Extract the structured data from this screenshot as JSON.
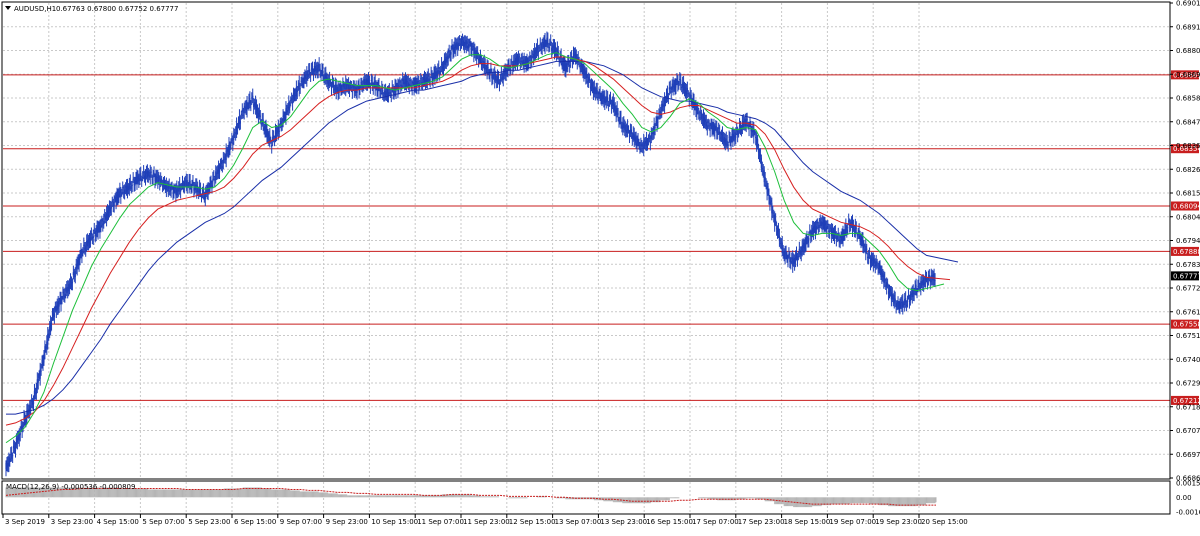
{
  "header": {
    "symbol": "AUDUSD,H1",
    "ohlc": "0.67763 0.67800 0.67752 0.67777",
    "indicator": "MACD(12,26,9) -0.000536 -0.000809"
  },
  "colors": {
    "candle": "#1f3fb8",
    "ma_fast": "#1dbf3a",
    "ma_mid": "#d62020",
    "ma_slow": "#1a2fa8",
    "level": "#c81e1e",
    "grid": "#c9c9c9",
    "macd_signal": "#c81e1e",
    "macd_hist": "#b5b5b5"
  },
  "chart_data": {
    "type": "candlestick",
    "y_axis": {
      "min": 0.6686,
      "max": 0.69015,
      "ticks": [
        "0.69015",
        "0.68910",
        "0.68800",
        "0.68695",
        "0.68585",
        "0.68475",
        "0.68365",
        "0.68260",
        "0.68150",
        "0.68045",
        "0.67940",
        "0.67830",
        "0.67725",
        "0.67615",
        "0.67510",
        "0.67400",
        "0.67290",
        "0.67185",
        "0.67075",
        "0.66970",
        "0.66860"
      ]
    },
    "x_labels": [
      "3 Sep 2019",
      "3 Sep 23:00",
      "4 Sep 15:00",
      "5 Sep 07:00",
      "5 Sep 23:00",
      "6 Sep 15:00",
      "9 Sep 07:00",
      "9 Sep 23:00",
      "10 Sep 15:00",
      "11 Sep 07:00",
      "11 Sep 23:00",
      "12 Sep 15:00",
      "13 Sep 07:00",
      "13 Sep 23:00",
      "16 Sep 15:00",
      "17 Sep 07:00",
      "17 Sep 23:00",
      "18 Sep 15:00",
      "19 Sep 07:00",
      "19 Sep 23:00",
      "20 Sep 15:00"
    ],
    "levels": [
      {
        "value": 0.68689,
        "label": "0.68689"
      },
      {
        "value": 0.68354,
        "label": "0.68354"
      },
      {
        "value": 0.68094,
        "label": "0.68094"
      },
      {
        "value": 0.67888,
        "label": "0.67888"
      },
      {
        "value": 0.67558,
        "label": "0.67558"
      },
      {
        "value": 0.67212,
        "label": "0.67212"
      }
    ],
    "current_price": {
      "value": 0.67777,
      "label": "0.67777"
    },
    "closes": [
      0.669,
      0.67,
      0.6712,
      0.6722,
      0.674,
      0.676,
      0.6768,
      0.6775,
      0.6788,
      0.6795,
      0.68,
      0.6808,
      0.6815,
      0.6818,
      0.6822,
      0.6824,
      0.6822,
      0.6818,
      0.6816,
      0.682,
      0.6818,
      0.6814,
      0.6822,
      0.683,
      0.684,
      0.6852,
      0.6858,
      0.6848,
      0.6838,
      0.6846,
      0.6856,
      0.6864,
      0.687,
      0.6872,
      0.6866,
      0.6862,
      0.6864,
      0.6862,
      0.6866,
      0.6864,
      0.686,
      0.6862,
      0.6866,
      0.6864,
      0.6866,
      0.6868,
      0.6872,
      0.688,
      0.6884,
      0.6882,
      0.6876,
      0.687,
      0.6866,
      0.6872,
      0.6876,
      0.6874,
      0.688,
      0.6884,
      0.688,
      0.6872,
      0.6878,
      0.687,
      0.6862,
      0.6858,
      0.6856,
      0.6846,
      0.6842,
      0.6836,
      0.684,
      0.6852,
      0.6862,
      0.6866,
      0.686,
      0.6852,
      0.6846,
      0.6844,
      0.6838,
      0.6842,
      0.6848,
      0.6842,
      0.6822,
      0.6804,
      0.6788,
      0.6784,
      0.679,
      0.6798,
      0.6802,
      0.6798,
      0.6794,
      0.6802,
      0.6796,
      0.6786,
      0.6782,
      0.6772,
      0.6764,
      0.6766,
      0.6772,
      0.6776,
      0.6777
    ],
    "ma_fast": [
      0.6702,
      0.6705,
      0.6709,
      0.6716,
      0.6725,
      0.6738,
      0.675,
      0.6762,
      0.6772,
      0.6782,
      0.679,
      0.6797,
      0.6804,
      0.681,
      0.6814,
      0.6818,
      0.682,
      0.6819,
      0.6818,
      0.6818,
      0.6818,
      0.6817,
      0.6818,
      0.6822,
      0.6828,
      0.6836,
      0.6845,
      0.6848,
      0.6845,
      0.6846,
      0.685,
      0.6856,
      0.6862,
      0.6866,
      0.6867,
      0.6866,
      0.6865,
      0.6864,
      0.6864,
      0.6864,
      0.6863,
      0.6862,
      0.6863,
      0.6864,
      0.6865,
      0.6866,
      0.6868,
      0.6872,
      0.6876,
      0.6878,
      0.6878,
      0.6876,
      0.6873,
      0.6872,
      0.6873,
      0.6874,
      0.6876,
      0.6878,
      0.6879,
      0.6877,
      0.6876,
      0.6874,
      0.687,
      0.6866,
      0.6862,
      0.6856,
      0.6851,
      0.6845,
      0.6843,
      0.6845,
      0.685,
      0.6856,
      0.6858,
      0.6856,
      0.6852,
      0.6849,
      0.6845,
      0.6844,
      0.6845,
      0.6844,
      0.6836,
      0.6825,
      0.6812,
      0.6802,
      0.6797,
      0.6796,
      0.6797,
      0.6797,
      0.6796,
      0.6797,
      0.6797,
      0.6793,
      0.6789,
      0.6783,
      0.6776,
      0.6772,
      0.6771,
      0.6772,
      0.6774
    ],
    "ma_mid": [
      0.671,
      0.6711,
      0.6713,
      0.6716,
      0.6721,
      0.6728,
      0.6736,
      0.6745,
      0.6754,
      0.6763,
      0.6771,
      0.6779,
      0.6786,
      0.6793,
      0.6799,
      0.6804,
      0.6808,
      0.681,
      0.6812,
      0.6813,
      0.6814,
      0.6815,
      0.6816,
      0.6818,
      0.6822,
      0.6827,
      0.6833,
      0.6837,
      0.6839,
      0.6841,
      0.6844,
      0.6848,
      0.6852,
      0.6856,
      0.6859,
      0.6861,
      0.6862,
      0.6862,
      0.6863,
      0.6863,
      0.6863,
      0.6863,
      0.6863,
      0.6863,
      0.6864,
      0.6865,
      0.6866,
      0.6868,
      0.6871,
      0.6873,
      0.6874,
      0.6874,
      0.6873,
      0.6873,
      0.6873,
      0.6874,
      0.6875,
      0.6876,
      0.6877,
      0.6877,
      0.6876,
      0.6875,
      0.6873,
      0.687,
      0.6867,
      0.6863,
      0.6859,
      0.6855,
      0.6852,
      0.6851,
      0.6852,
      0.6854,
      0.6855,
      0.6855,
      0.6853,
      0.6851,
      0.6849,
      0.6847,
      0.6847,
      0.6846,
      0.6842,
      0.6835,
      0.6826,
      0.6818,
      0.6812,
      0.6808,
      0.6806,
      0.6804,
      0.6802,
      0.6801,
      0.68,
      0.6798,
      0.6795,
      0.6791,
      0.6786,
      0.6782,
      0.6779,
      0.6777,
      0.6776
    ],
    "ma_slow": [
      0.6715,
      0.6715,
      0.6716,
      0.6717,
      0.6719,
      0.6722,
      0.6726,
      0.6731,
      0.6737,
      0.6743,
      0.6749,
      0.6756,
      0.6762,
      0.6768,
      0.6774,
      0.678,
      0.6785,
      0.6789,
      0.6793,
      0.6796,
      0.6799,
      0.6802,
      0.6804,
      0.6806,
      0.6809,
      0.6813,
      0.6817,
      0.6821,
      0.6824,
      0.6827,
      0.6831,
      0.6835,
      0.6839,
      0.6843,
      0.6847,
      0.685,
      0.6853,
      0.6855,
      0.6857,
      0.6858,
      0.6859,
      0.686,
      0.6861,
      0.6862,
      0.6862,
      0.6863,
      0.6864,
      0.6865,
      0.6866,
      0.6868,
      0.6869,
      0.687,
      0.687,
      0.6871,
      0.6871,
      0.6872,
      0.6873,
      0.6874,
      0.6875,
      0.6875,
      0.6875,
      0.6875,
      0.6874,
      0.6873,
      0.6871,
      0.6869,
      0.6866,
      0.6863,
      0.6861,
      0.6859,
      0.6858,
      0.6857,
      0.6857,
      0.6856,
      0.6855,
      0.6854,
      0.6852,
      0.6851,
      0.685,
      0.6849,
      0.6847,
      0.6844,
      0.6839,
      0.6834,
      0.6829,
      0.6825,
      0.6822,
      0.6819,
      0.6816,
      0.6814,
      0.6812,
      0.6809,
      0.6806,
      0.6802,
      0.6798,
      0.6794,
      0.679,
      0.6787,
      0.6784
    ],
    "macd": {
      "min": -0.0016,
      "max": 0.00156,
      "ticks": [
        "0.001561",
        "0.00",
        "-0.00160"
      ],
      "hist": [
        0.001,
        0.001,
        0.001,
        0.001,
        0.001,
        0.001,
        0.001,
        0.001,
        0.001,
        0.001,
        0.001,
        0.001,
        0.0009,
        0.0009,
        0.0009,
        0.0008,
        0.0008,
        0.0008,
        0.0008,
        0.0008,
        0.0008,
        0.0008,
        0.0008,
        0.0009,
        0.0009,
        0.001,
        0.001,
        0.0009,
        0.0008,
        0.0008,
        0.0007,
        0.0006,
        0.0006,
        0.0005,
        0.0004,
        0.0003,
        0.0002,
        0.0002,
        0.0002,
        0.0002,
        0.0002,
        0.0002,
        0.0002,
        0.0002,
        0.0002,
        0.0002,
        0.0003,
        0.0003,
        0.0003,
        0.0002,
        0.0001,
        0.0001,
        0.0,
        -0.0001,
        -0.0001,
        0.0,
        0.0001,
        0.0,
        -0.0001,
        -0.0002,
        -0.0002,
        -0.0002,
        -0.0003,
        -0.0004,
        -0.0005,
        -0.0006,
        -0.0006,
        -0.0006,
        -0.0005,
        -0.0003,
        -0.0001,
        0.0,
        0.0,
        -0.0001,
        -0.0002,
        -0.0003,
        -0.0003,
        -0.0002,
        -0.0001,
        -0.0002,
        -0.0004,
        -0.0007,
        -0.0009,
        -0.001,
        -0.001,
        -0.0009,
        -0.0008,
        -0.0007,
        -0.0007,
        -0.0006,
        -0.0006,
        -0.0007,
        -0.0008,
        -0.0009,
        -0.0009,
        -0.0009,
        -0.0008,
        -0.0006,
        -0.0005
      ],
      "signal": [
        0.0002,
        0.0003,
        0.0004,
        0.0005,
        0.0006,
        0.0007,
        0.0008,
        0.0008,
        0.0009,
        0.0009,
        0.0009,
        0.0009,
        0.0009,
        0.0009,
        0.0009,
        0.0009,
        0.0009,
        0.0009,
        0.0009,
        0.0008,
        0.0008,
        0.0008,
        0.0008,
        0.0008,
        0.0008,
        0.0009,
        0.0009,
        0.0009,
        0.0009,
        0.0009,
        0.0008,
        0.0008,
        0.0007,
        0.0007,
        0.0006,
        0.0005,
        0.0005,
        0.0004,
        0.0004,
        0.0003,
        0.0003,
        0.0003,
        0.0003,
        0.0003,
        0.0002,
        0.0002,
        0.0002,
        0.0003,
        0.0003,
        0.0003,
        0.0002,
        0.0002,
        0.0002,
        0.0001,
        0.0001,
        0.0001,
        0.0001,
        0.0001,
        0.0,
        0.0,
        -0.0001,
        -0.0001,
        -0.0001,
        -0.0002,
        -0.0002,
        -0.0003,
        -0.0004,
        -0.0004,
        -0.0004,
        -0.0004,
        -0.0004,
        -0.0003,
        -0.0003,
        -0.0002,
        -0.0002,
        -0.0002,
        -0.0002,
        -0.0002,
        -0.0002,
        -0.0002,
        -0.0002,
        -0.0003,
        -0.0004,
        -0.0005,
        -0.0006,
        -0.0007,
        -0.0007,
        -0.0007,
        -0.0007,
        -0.0007,
        -0.0007,
        -0.0007,
        -0.0007,
        -0.0007,
        -0.0008,
        -0.0008,
        -0.0008,
        -0.0008,
        -0.0008
      ]
    }
  }
}
